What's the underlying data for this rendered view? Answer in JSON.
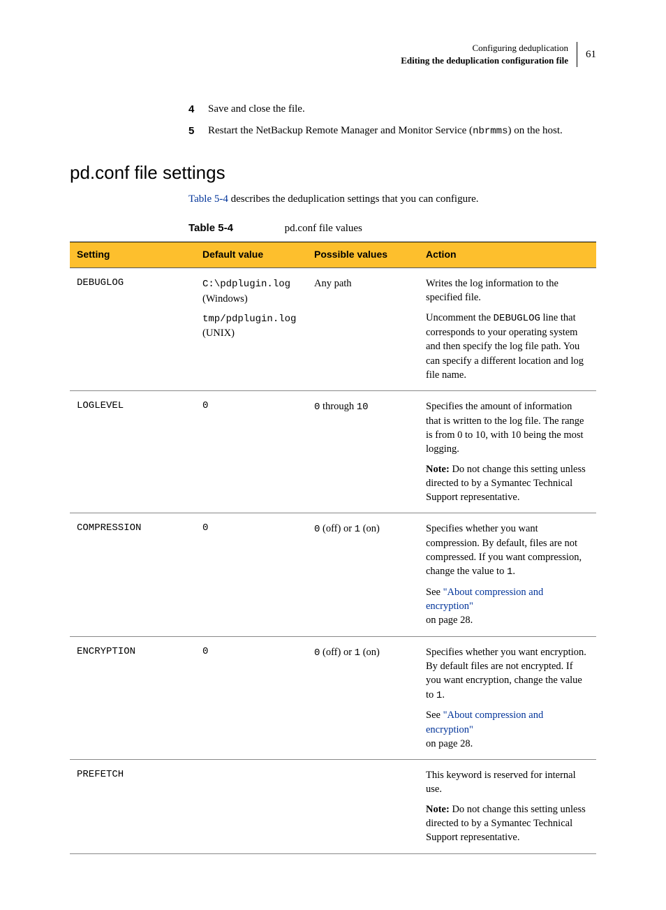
{
  "header": {
    "chapter": "Configuring deduplication",
    "section": "Editing the deduplication configuration file",
    "page": "61"
  },
  "steps": [
    {
      "num": "4",
      "text": "Save and close the file."
    },
    {
      "num": "5",
      "text_before": "Restart the NetBackup Remote Manager and Monitor Service (",
      "code": "nbrmms",
      "text_after": ") on the host."
    }
  ],
  "heading": "pd.conf file settings",
  "intro_link": "Table 5-4",
  "intro_rest": " describes the deduplication settings that you can configure.",
  "table_label": "Table 5-4",
  "table_title": "pd.conf file values",
  "columns": {
    "setting": "Setting",
    "default": "Default value",
    "possible": "Possible values",
    "action": "Action"
  },
  "rows": {
    "debuglog": {
      "setting": "DEBUGLOG",
      "default_code1": "C:\\pdplugin.log",
      "default_os1": "(Windows)",
      "default_code2": "tmp/pdplugin.log",
      "default_os2": "(UNIX)",
      "possible": "Any path",
      "action_p1": "Writes the log information to the specified file.",
      "action_p2a": "Uncomment the ",
      "action_p2code": "DEBUGLOG",
      "action_p2b": " line that corresponds to your operating system and then specify the log file path. You can specify a different location and log file name."
    },
    "loglevel": {
      "setting": "LOGLEVEL",
      "default": "0",
      "possible_a": "0",
      "possible_mid": " through ",
      "possible_b": "10",
      "action_p1": "Specifies the amount of information that is written to the log file. The range is from 0 to 10, with 10 being the most logging.",
      "action_note_label": "Note:",
      "action_note": " Do not change this setting unless directed to by a Symantec Technical Support representative."
    },
    "compression": {
      "setting": "COMPRESSION",
      "default": "0",
      "possible_a": "0",
      "possible_off": " (off) or ",
      "possible_b": "1",
      "possible_on": " (on)",
      "action_p1a": "Specifies whether you want compression. By default, files are not compressed. If you want compression, change the value to ",
      "action_p1code": "1",
      "action_p1b": ".",
      "action_see": "See ",
      "action_link": "\"About compression and encryption\"",
      "action_page": "on page 28."
    },
    "encryption": {
      "setting": "ENCRYPTION",
      "default": "0",
      "possible_a": "0",
      "possible_off": " (off) or ",
      "possible_b": "1",
      "possible_on": " (on)",
      "action_p1a": "Specifies whether you want encryption. By default files are not encrypted. If you want encryption, change the value to ",
      "action_p1code": "1",
      "action_p1b": ".",
      "action_see": "See ",
      "action_link": "\"About compression and encryption\"",
      "action_page": "on page 28."
    },
    "prefetch": {
      "setting": "PREFETCH",
      "action_p1": "This keyword is reserved for internal use.",
      "action_note_label": "Note:",
      "action_note": " Do not change this setting unless directed to by a Symantec Technical Support representative."
    }
  }
}
